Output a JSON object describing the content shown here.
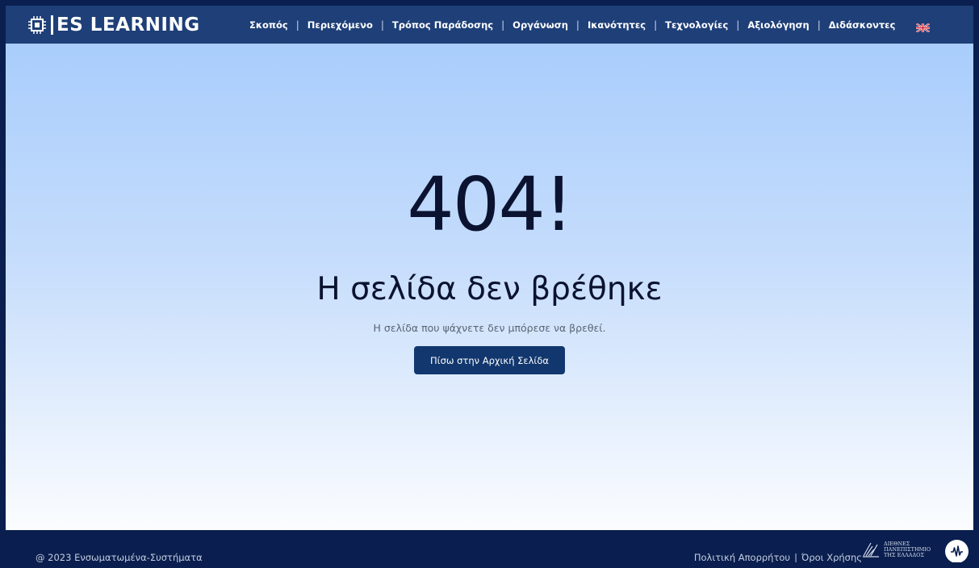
{
  "header": {
    "brand": "ES LEARNING",
    "nav": [
      {
        "label": "Σκοπός"
      },
      {
        "label": "Περιεχόμενο"
      },
      {
        "label": "Τρόπος Παράδοσης"
      },
      {
        "label": "Οργάνωση"
      },
      {
        "label": "Ικανότητες"
      },
      {
        "label": "Τεχνολογίες"
      },
      {
        "label": "Αξιολόγηση"
      },
      {
        "label": "Διδάσκοντες"
      }
    ],
    "language_icon": "uk-flag-icon"
  },
  "main": {
    "code": "404!",
    "title": "Η σελίδα δεν βρέθηκε",
    "subtitle": "Η σελίδα που ψάχνετε δεν μπόρεσε να βρεθεί.",
    "home_button": "Πίσω στην Αρχική Σελίδα"
  },
  "footer": {
    "copyright": "@ 2023 Ενσωματωμένα-Συστήματα",
    "privacy": "Πολιτική Απορρήτου",
    "separator": "|",
    "terms": "Όροι Χρήσης",
    "university_lines": [
      "ΔΙΕΘΝΕΣ",
      "ΠΑΝΕΠΙΣΤΗΜΙΟ",
      "ΤΗΣ ΕΛΛΑΔΟΣ"
    ]
  },
  "colors": {
    "header_bg": "#1e3f78",
    "footer_bg": "#0a1f4f",
    "button_bg": "#12376e",
    "gradient_top": "#a9cdfc",
    "gradient_bottom": "#fbfdff"
  }
}
